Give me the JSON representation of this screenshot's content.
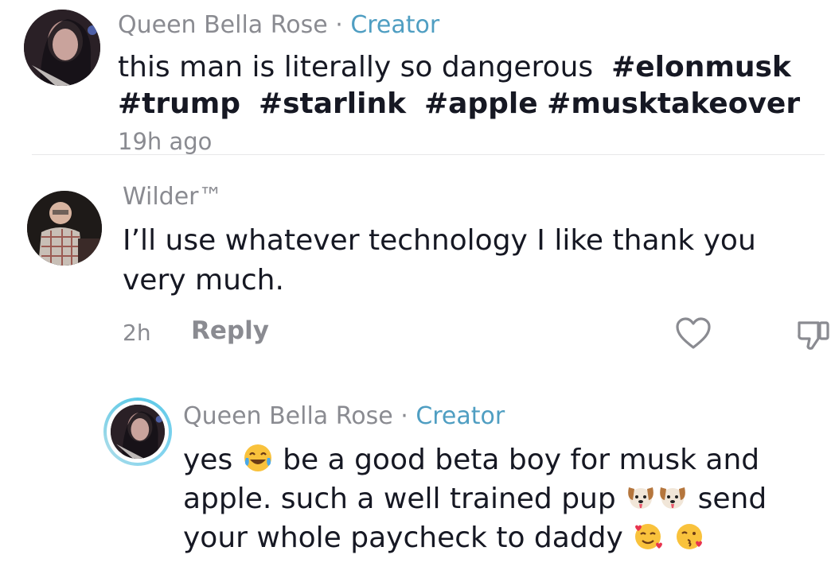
{
  "comment1": {
    "username": "Queen Bella Rose",
    "separator": "·",
    "badge": "Creator",
    "text": "this man is literally so dangerous",
    "hashtags": [
      "#elonmusk",
      "#trump",
      "#starlink",
      "#apple",
      "#musktakeover"
    ],
    "time": "19h ago"
  },
  "comment2": {
    "username": "Wilder™",
    "text": "I’ll use whatever technology I like thank you very much.",
    "time": "2h",
    "reply_label": "Reply"
  },
  "reply1": {
    "username": "Queen Bella Rose",
    "separator": "·",
    "badge": "Creator",
    "text_part1": "yes",
    "text_part2": "be a good beta boy for musk and apple. such a well trained pup",
    "text_part3": "send your whole paycheck to daddy",
    "emojis": [
      "tears-of-joy-emoji",
      "dog-face-emoji",
      "dog-face-emoji",
      "smiling-face-with-hearts-emoji",
      "face-blowing-kiss-emoji"
    ]
  },
  "colors": {
    "creator_badge": "#4f9ec2",
    "secondary_text": "#8a8b91",
    "primary_text": "#161823",
    "story_ring": "#5ac8e6"
  },
  "icons": [
    "heart-outline-icon",
    "thumbs-down-outline-icon"
  ]
}
